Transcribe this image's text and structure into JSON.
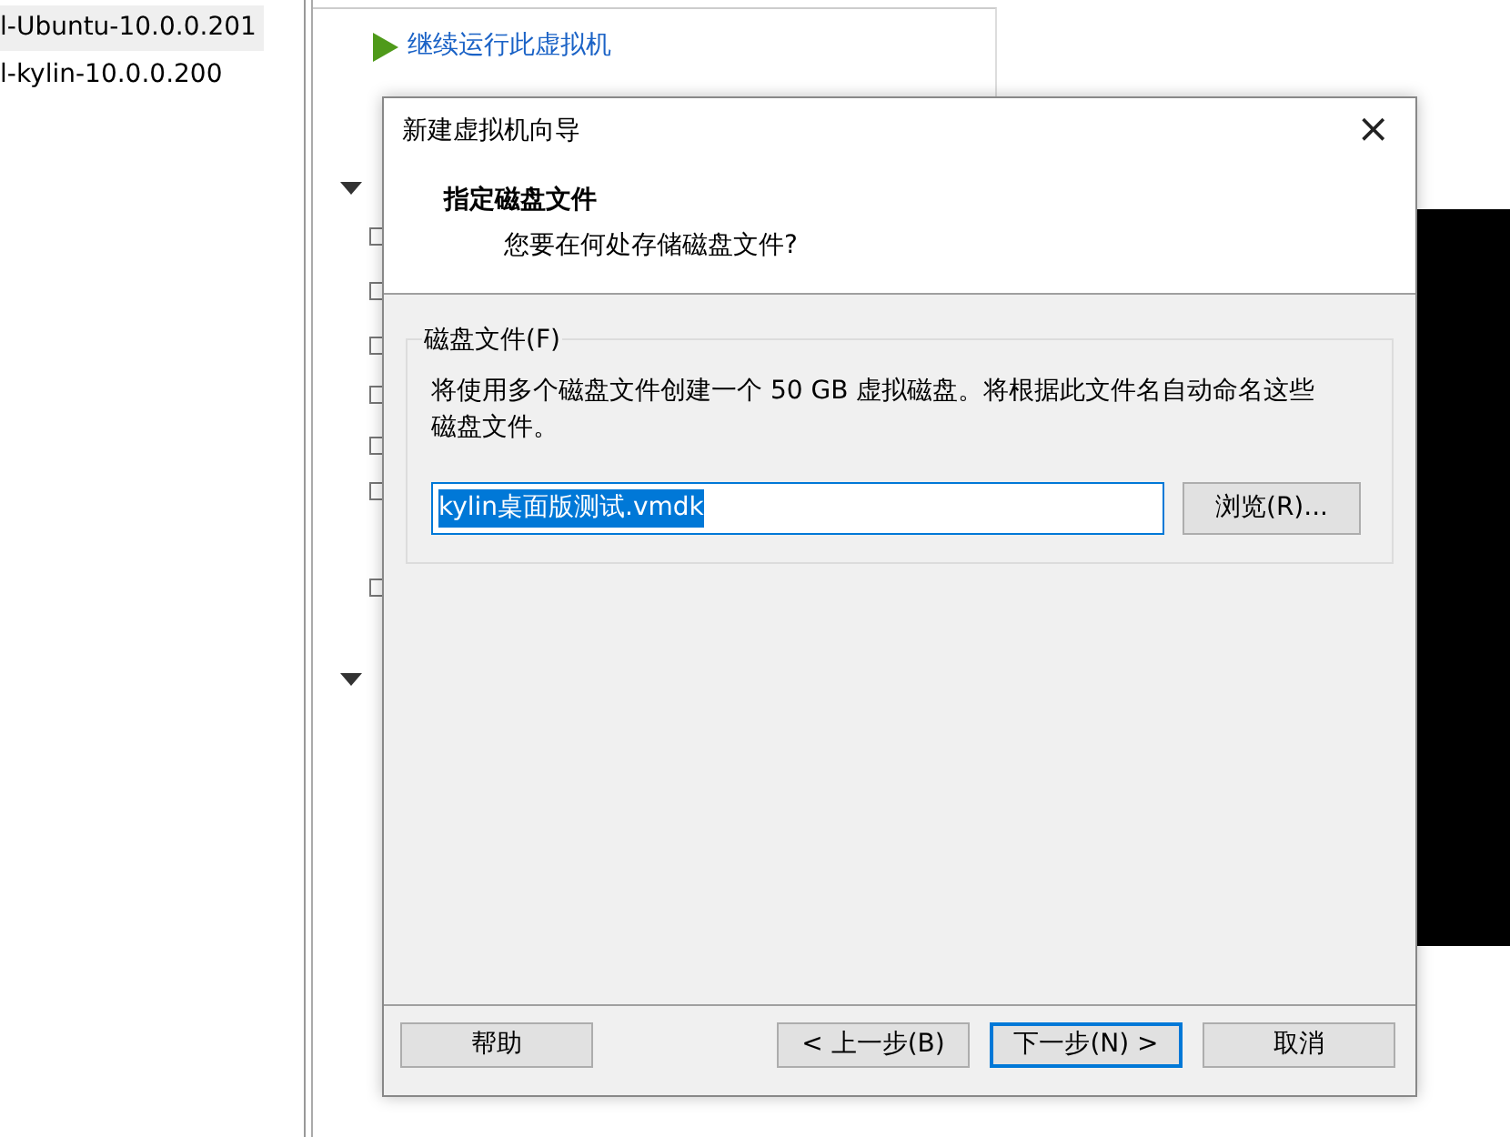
{
  "vm_list": [
    {
      "label": "l-Ubuntu-10.0.0.201",
      "selected": true
    },
    {
      "label": "l-kylin-10.0.0.200",
      "selected": false
    }
  ],
  "actions": [
    {
      "label": "继续运行此虚拟机"
    }
  ],
  "dialog": {
    "title": "新建虚拟机向导",
    "close": "×",
    "heading": "指定磁盘文件",
    "subheading": "您要在何处存储磁盘文件?",
    "group": {
      "label": "磁盘文件(F)",
      "description": "将使用多个磁盘文件创建一个 50 GB 虚拟磁盘。将根据此文件名自动命名这些磁盘文件。",
      "file": {
        "value": "kylin桌面版测试.vmdk",
        "selected": true
      },
      "browse": "浏览(R)..."
    },
    "buttons": [
      {
        "label": "帮助",
        "kind": "help",
        "default": false
      },
      {
        "label": "< 上一步(B)",
        "kind": "nav",
        "default": false
      },
      {
        "label": "下一步(N) >",
        "kind": "nav",
        "default": true
      },
      {
        "label": "取消",
        "kind": "nav",
        "default": false
      }
    ]
  }
}
